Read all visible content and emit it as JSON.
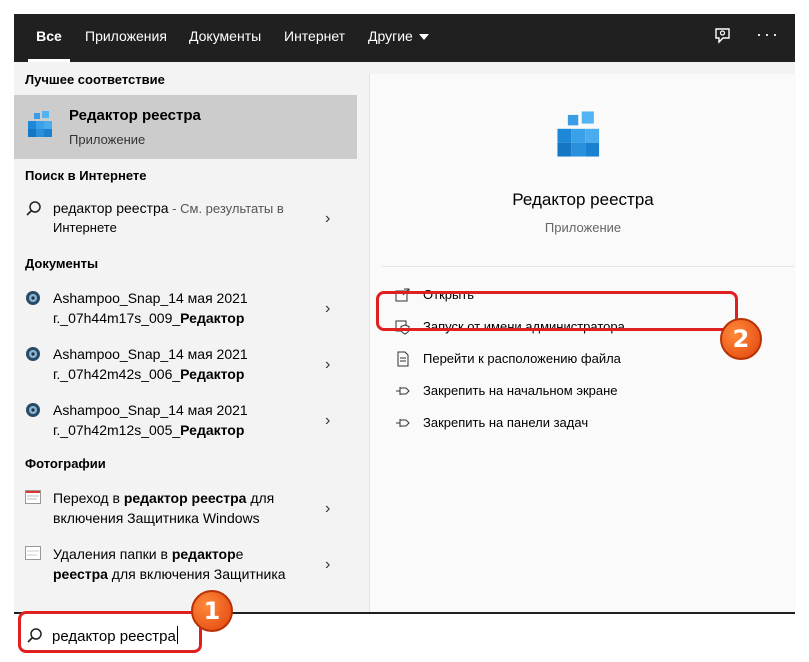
{
  "tabs": [
    {
      "label": "Все",
      "active": true
    },
    {
      "label": "Приложения"
    },
    {
      "label": "Документы"
    },
    {
      "label": "Интернет"
    },
    {
      "label": "Другие"
    }
  ],
  "toolbar": {
    "feedback_icon": "feedback-icon",
    "more_label": "···"
  },
  "sections": {
    "best": "Лучшее соответствие",
    "web": "Поиск в Интернете",
    "docs": "Документы",
    "photos": "Фотографии"
  },
  "best_match": {
    "title": "Редактор реестра",
    "subtitle": "Приложение"
  },
  "web_result": {
    "query": "редактор реестра",
    "suffix": " - См. результаты в",
    "line2": "Интернете"
  },
  "documents": [
    {
      "line1": "Ashampoo_Snap_14 мая 2021",
      "line2_prefix": "г._07h44m17s_009_",
      "line2_bold": "Редактор"
    },
    {
      "line1": "Ashampoo_Snap_14 мая 2021",
      "line2_prefix": "г._07h42m42s_006_",
      "line2_bold": "Редактор"
    },
    {
      "line1": "Ashampoo_Snap_14 мая 2021",
      "line2_prefix": "г._07h42m12s_005_",
      "line2_bold": "Редактор"
    }
  ],
  "photos": [
    {
      "a": "Переход в ",
      "b": "редактор реестра",
      "c": " для",
      "line2": "включения Защитника Windows"
    },
    {
      "a": "Удаления папки в ",
      "b": "редактор",
      "c": "е",
      "line2_bold": "реестра",
      "line2_rest": " для включения Защитника"
    }
  ],
  "detail": {
    "title": "Редактор реестра",
    "subtitle": "Приложение"
  },
  "actions": [
    {
      "label": "Открыть",
      "icon": "open-icon"
    },
    {
      "label": "Запуск от имени администратора",
      "icon": "shield-icon"
    },
    {
      "label": "Перейти к расположению файла",
      "icon": "file-location-icon"
    },
    {
      "label": "Закрепить на начальном экране",
      "icon": "pin-icon"
    },
    {
      "label": "Закрепить на панели задач",
      "icon": "pin-icon"
    }
  ],
  "search": {
    "value": "редактор реестра"
  },
  "annotations": {
    "badge1": "1",
    "badge2": "2"
  },
  "colors": {
    "accent_red": "#e02020",
    "badge_orange": "#f06a1e",
    "tabbar": "#202020"
  }
}
